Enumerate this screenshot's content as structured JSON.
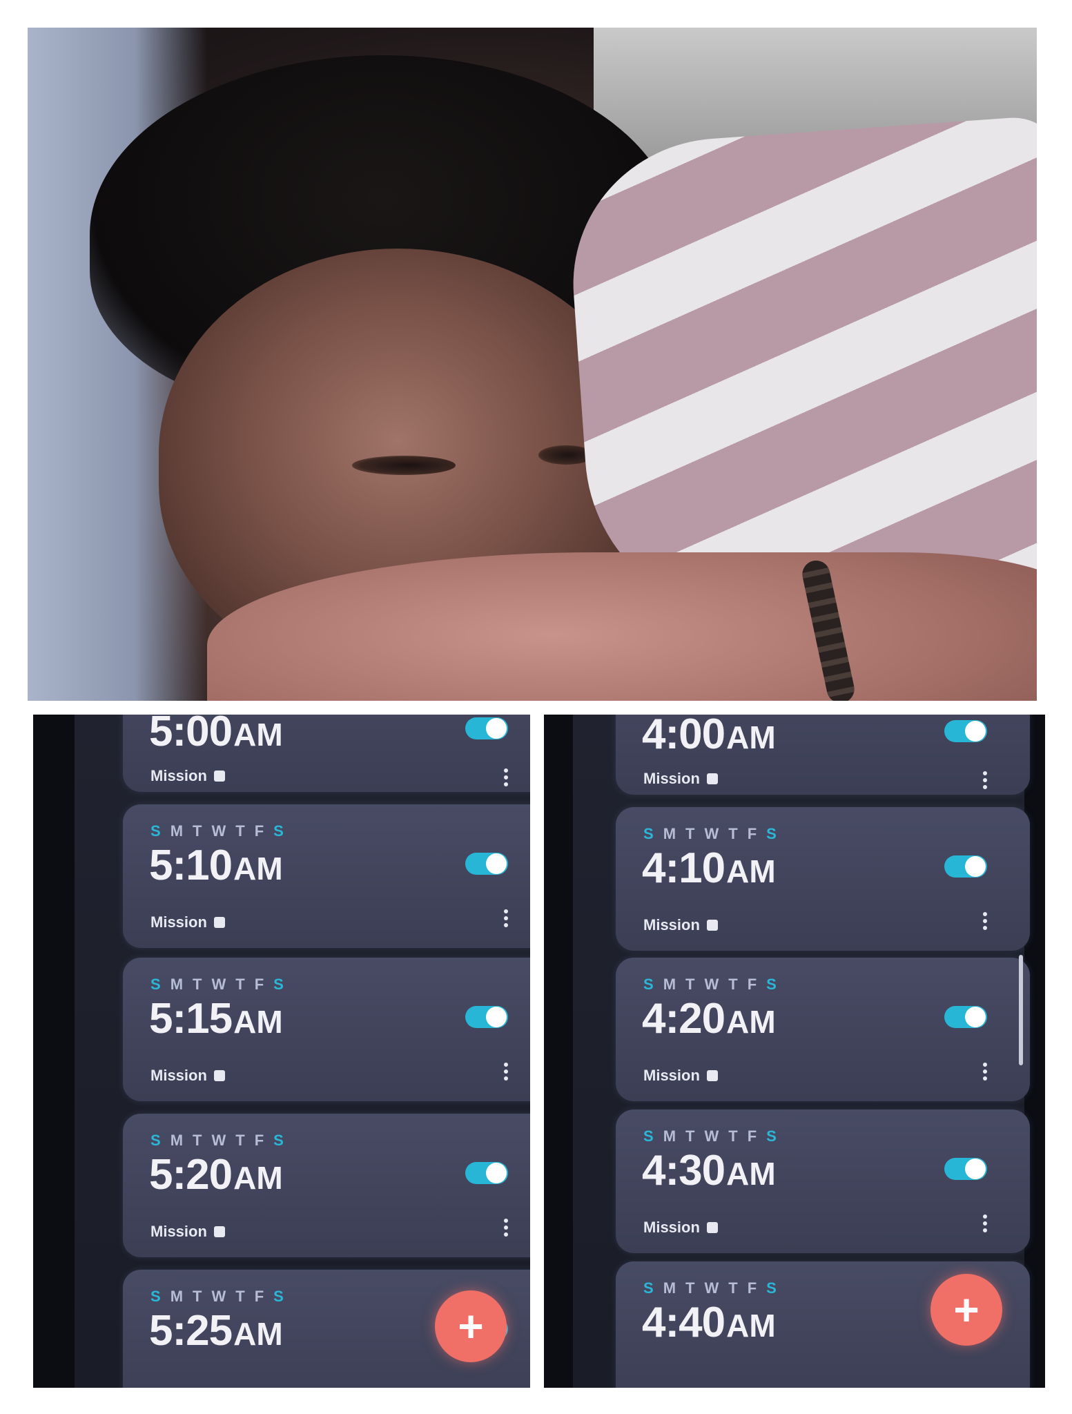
{
  "left_phone": {
    "alarms": [
      {
        "days": [],
        "time": "5:00",
        "ampm": "AM",
        "mission_label": "Mission",
        "enabled": true
      },
      {
        "days": [
          "S",
          "M",
          "T",
          "W",
          "T",
          "F",
          "S"
        ],
        "time": "5:10",
        "ampm": "AM",
        "mission_label": "Mission",
        "enabled": true
      },
      {
        "days": [
          "S",
          "M",
          "T",
          "W",
          "T",
          "F",
          "S"
        ],
        "time": "5:15",
        "ampm": "AM",
        "mission_label": "Mission",
        "enabled": true
      },
      {
        "days": [
          "S",
          "M",
          "T",
          "W",
          "T",
          "F",
          "S"
        ],
        "time": "5:20",
        "ampm": "AM",
        "mission_label": "Mission",
        "enabled": true
      },
      {
        "days": [
          "S",
          "M",
          "T",
          "W",
          "T",
          "F",
          "S"
        ],
        "time": "5:25",
        "ampm": "AM",
        "mission_label": "",
        "enabled": true
      }
    ],
    "fab_label": "+"
  },
  "right_phone": {
    "alarms": [
      {
        "days": [],
        "time": "4:00",
        "ampm": "AM",
        "mission_label": "Mission",
        "enabled": true
      },
      {
        "days": [
          "S",
          "M",
          "T",
          "W",
          "T",
          "F",
          "S"
        ],
        "time": "4:10",
        "ampm": "AM",
        "mission_label": "Mission",
        "enabled": true
      },
      {
        "days": [
          "S",
          "M",
          "T",
          "W",
          "T",
          "F",
          "S"
        ],
        "time": "4:20",
        "ampm": "AM",
        "mission_label": "Mission",
        "enabled": true
      },
      {
        "days": [
          "S",
          "M",
          "T",
          "W",
          "T",
          "F",
          "S"
        ],
        "time": "4:30",
        "ampm": "AM",
        "mission_label": "Mission",
        "enabled": true
      },
      {
        "days": [
          "S",
          "M",
          "T",
          "W",
          "T",
          "F",
          "S"
        ],
        "time": "4:40",
        "ampm": "AM",
        "mission_label": "",
        "enabled": true
      }
    ],
    "fab_label": "+"
  },
  "colors": {
    "accent_toggle": "#27b6d6",
    "fab": "#f06f66",
    "card": "#43465d",
    "weekend_day": "#2bb7d8",
    "weekday": "#b7bdd6"
  },
  "icons": {
    "add": "plus-icon",
    "more": "more-vertical-icon",
    "mission": "square-icon"
  }
}
